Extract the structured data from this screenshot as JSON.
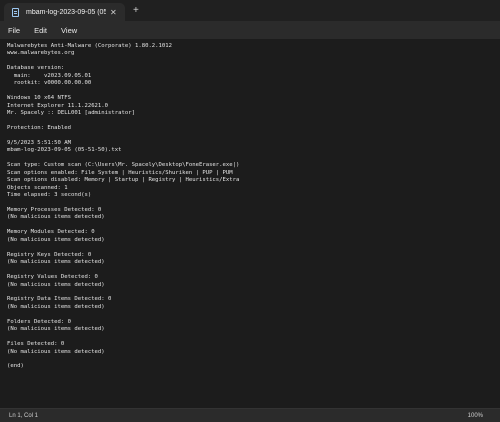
{
  "tab": {
    "title": "mbam-log-2023-09-05 (05-51-",
    "close_glyph": "✕",
    "new_tab_glyph": "+"
  },
  "menu": {
    "items": [
      "File",
      "Edit",
      "View"
    ]
  },
  "document": {
    "lines": [
      "Malwarebytes Anti-Malware (Corporate) 1.80.2.1012",
      "www.malwarebytes.org",
      "",
      "Database version:",
      "  main:    v2023.09.05.01",
      "  rootkit: v0000.00.00.00",
      "",
      "Windows 10 x64 NTFS",
      "Internet Explorer 11.1.22621.0",
      "Mr. Spacely :: DELL001 [administrator]",
      "",
      "Protection: Enabled",
      "",
      "9/5/2023 5:51:50 AM",
      "mbam-log-2023-09-05 (05-51-50).txt",
      "",
      "Scan type: Custom scan (C:\\Users\\Mr. Spacely\\Desktop\\FoneEraser.exe|)",
      "Scan options enabled: File System | Heuristics/Shuriken | PUP | PUM",
      "Scan options disabled: Memory | Startup | Registry | Heuristics/Extra",
      "Objects scanned: 1",
      "Time elapsed: 3 second(s)",
      "",
      "Memory Processes Detected: 0",
      "(No malicious items detected)",
      "",
      "Memory Modules Detected: 0",
      "(No malicious items detected)",
      "",
      "Registry Keys Detected: 0",
      "(No malicious items detected)",
      "",
      "Registry Values Detected: 0",
      "(No malicious items detected)",
      "",
      "Registry Data Items Detected: 0",
      "(No malicious items detected)",
      "",
      "Folders Detected: 0",
      "(No malicious items detected)",
      "",
      "Files Detected: 0",
      "(No malicious items detected)",
      "",
      "(end)"
    ]
  },
  "status": {
    "position": "Ln 1, Col 1",
    "zoom": "100%"
  },
  "icons": {
    "tab_icon": "notepad-icon"
  }
}
